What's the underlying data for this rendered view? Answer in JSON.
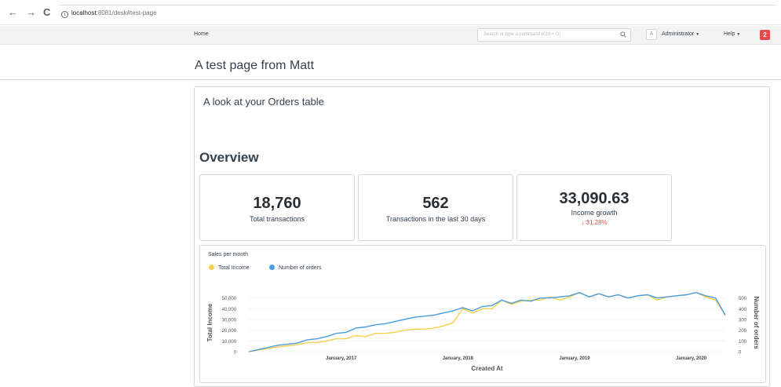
{
  "browser": {
    "back": "←",
    "forward": "→",
    "reload": "C",
    "url_host": "localhost",
    "url_path": ":8081/desk#test-page"
  },
  "navbar": {
    "home": "Home",
    "search_placeholder": "Search or type a command (Ctrl + G)",
    "user_initial": "A",
    "user_name": "Administrator",
    "help": "Help",
    "notification_count": "2"
  },
  "page": {
    "title": "A test page from Matt",
    "card_heading": "A look at your Orders table",
    "section_title": "Overview"
  },
  "stats": [
    {
      "value": "18,760",
      "label": "Total transactions"
    },
    {
      "value": "562",
      "label": "Transactions in the last 30 days"
    },
    {
      "value": "33,090.63",
      "label": "Income growth",
      "delta": "↓ 31.28%"
    }
  ],
  "chart_data": {
    "type": "line",
    "title": "Sales per month",
    "xlabel": "Created At",
    "ylabel": "Total Income",
    "y2label": "Number of orders",
    "x_tick_labels": [
      "January, 2017",
      "January, 2018",
      "January, 2019",
      "January, 2020"
    ],
    "y_ticks": [
      "0",
      "10,000",
      "20,000",
      "30,000",
      "40,000",
      "50,000"
    ],
    "y2_ticks": [
      "0",
      "100",
      "200",
      "300",
      "400",
      "500"
    ],
    "ylim": [
      0,
      57000
    ],
    "y2lim": [
      0,
      570
    ],
    "grid": true,
    "legend": "top-left",
    "colors": {
      "income": "#f5d04e",
      "orders": "#4a9de0"
    },
    "series": [
      {
        "name": "Total Income",
        "values": [
          0,
          1500,
          3000,
          4500,
          5500,
          6500,
          8500,
          8500,
          10000,
          12000,
          12000,
          15000,
          14000,
          17000,
          17000,
          18000,
          20000,
          21000,
          21000,
          22000,
          24000,
          27000,
          40000,
          36000,
          40000,
          40000,
          48000,
          44000,
          47000,
          48000,
          48000,
          51000,
          48000,
          51000,
          55000,
          51000,
          54000,
          51000,
          53000,
          50000,
          52000,
          53000,
          48000,
          51000,
          52000,
          53000,
          55000,
          51000,
          48000,
          34000
        ]
      },
      {
        "name": "Number of orders",
        "values": [
          0,
          20,
          40,
          60,
          70,
          80,
          110,
          120,
          140,
          170,
          180,
          220,
          230,
          250,
          260,
          280,
          300,
          320,
          330,
          340,
          360,
          380,
          410,
          380,
          420,
          430,
          480,
          450,
          480,
          470,
          500,
          500,
          510,
          520,
          550,
          510,
          540,
          510,
          530,
          500,
          520,
          530,
          500,
          510,
          520,
          530,
          550,
          520,
          500,
          340
        ]
      }
    ]
  }
}
